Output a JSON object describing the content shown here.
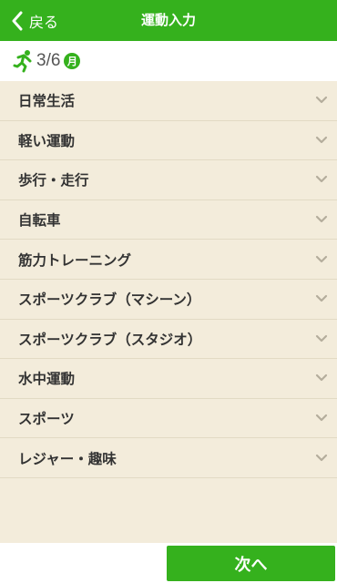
{
  "header": {
    "back_label": "戻る",
    "title": "運動入力"
  },
  "date_bar": {
    "date": "3/6",
    "day": "月"
  },
  "categories": [
    {
      "label": "日常生活"
    },
    {
      "label": "軽い運動"
    },
    {
      "label": "歩行・走行"
    },
    {
      "label": "自転車"
    },
    {
      "label": "筋力トレーニング"
    },
    {
      "label": "スポーツクラブ（マシーン）"
    },
    {
      "label": "スポーツクラブ（スタジオ）"
    },
    {
      "label": "水中運動"
    },
    {
      "label": "スポーツ"
    },
    {
      "label": "レジャー・趣味"
    }
  ],
  "footer": {
    "next_label": "次へ"
  },
  "icons": {
    "back": "chevron-left-icon",
    "runner": "runner-icon",
    "expand": "chevron-down-icon"
  },
  "colors": {
    "brand": "#35b11d",
    "background": "#f3ecdb",
    "text": "#333333",
    "chevron": "#b4ad9c"
  }
}
